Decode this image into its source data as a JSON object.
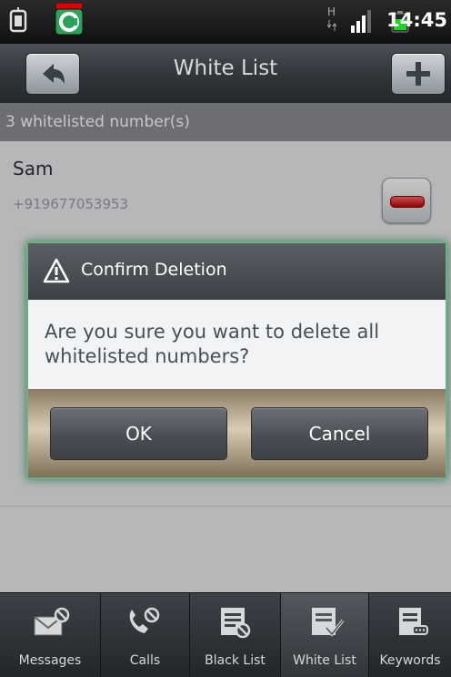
{
  "status_bar": {
    "time": "14:45",
    "network_label": "H"
  },
  "header": {
    "title": "White List"
  },
  "list": {
    "count_text": "3 whitelisted number(s)",
    "items": [
      {
        "name": "Sam",
        "number": "+919677053953"
      }
    ]
  },
  "dialog": {
    "title": "Confirm Deletion",
    "message": "Are you sure you want to delete all whitelisted numbers?",
    "ok_label": "OK",
    "cancel_label": "Cancel"
  },
  "tabs": [
    {
      "label": "Messages",
      "icon": "messages-block-icon"
    },
    {
      "label": "Calls",
      "icon": "calls-block-icon"
    },
    {
      "label": "Black List",
      "icon": "black-list-icon"
    },
    {
      "label": "White List",
      "icon": "white-list-icon",
      "selected": true
    },
    {
      "label": "Keywords",
      "icon": "keywords-icon"
    }
  ],
  "colors": {
    "dialog_border": "#6fae88",
    "delete_red": "#c40000"
  }
}
